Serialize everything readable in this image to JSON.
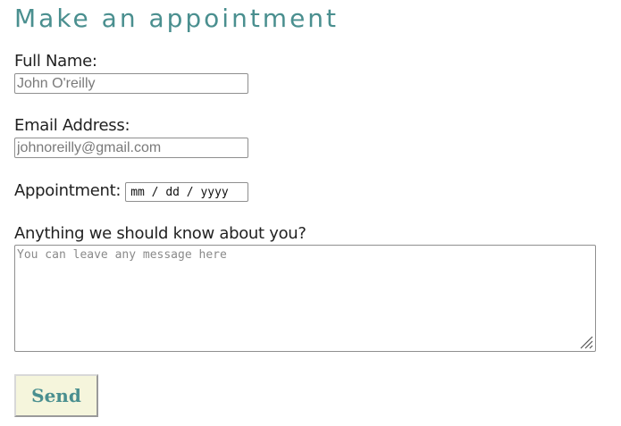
{
  "form": {
    "title": "Make an appointment",
    "full_name": {
      "label": "Full Name:",
      "placeholder": "John O'reilly"
    },
    "email": {
      "label": "Email Address:",
      "placeholder": "johnoreilly@gmail.com"
    },
    "appointment": {
      "label": "Appointment:",
      "date_placeholder": "mm / dd / yyyy"
    },
    "message": {
      "label": "Anything we should know about you?",
      "placeholder": "You can leave any message here"
    },
    "send_label": "Send"
  },
  "colors": {
    "title": "#4a8f8f",
    "button_bg": "#f5f5dc",
    "button_text": "#4a8f8f"
  }
}
